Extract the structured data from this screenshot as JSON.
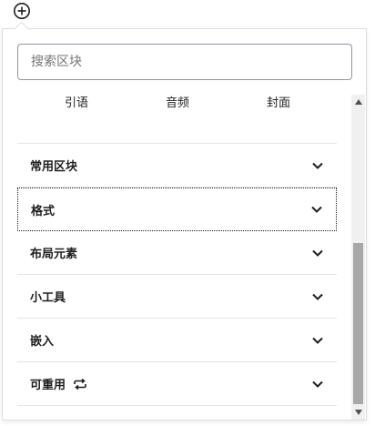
{
  "inserter": {
    "add_icon": "plus-circle-icon"
  },
  "search": {
    "placeholder": "搜索区块"
  },
  "recent_blocks": [
    {
      "label": "引语"
    },
    {
      "label": "音频"
    },
    {
      "label": "封面"
    }
  ],
  "panels": [
    {
      "title": "常用区块",
      "icon": "chevron-down-icon"
    },
    {
      "title": "格式",
      "icon": "chevron-down-icon"
    },
    {
      "title": "布局元素",
      "icon": "chevron-down-icon"
    },
    {
      "title": "小工具",
      "icon": "chevron-down-icon"
    },
    {
      "title": "嵌入",
      "icon": "chevron-down-icon"
    },
    {
      "title": "可重用",
      "icon": "chevron-down-icon",
      "extra_icon": "reusable-loop-icon"
    }
  ],
  "colors": {
    "text": "#1e1e1e",
    "border": "#dddddd",
    "scroll_thumb": "#a8a8a8"
  }
}
